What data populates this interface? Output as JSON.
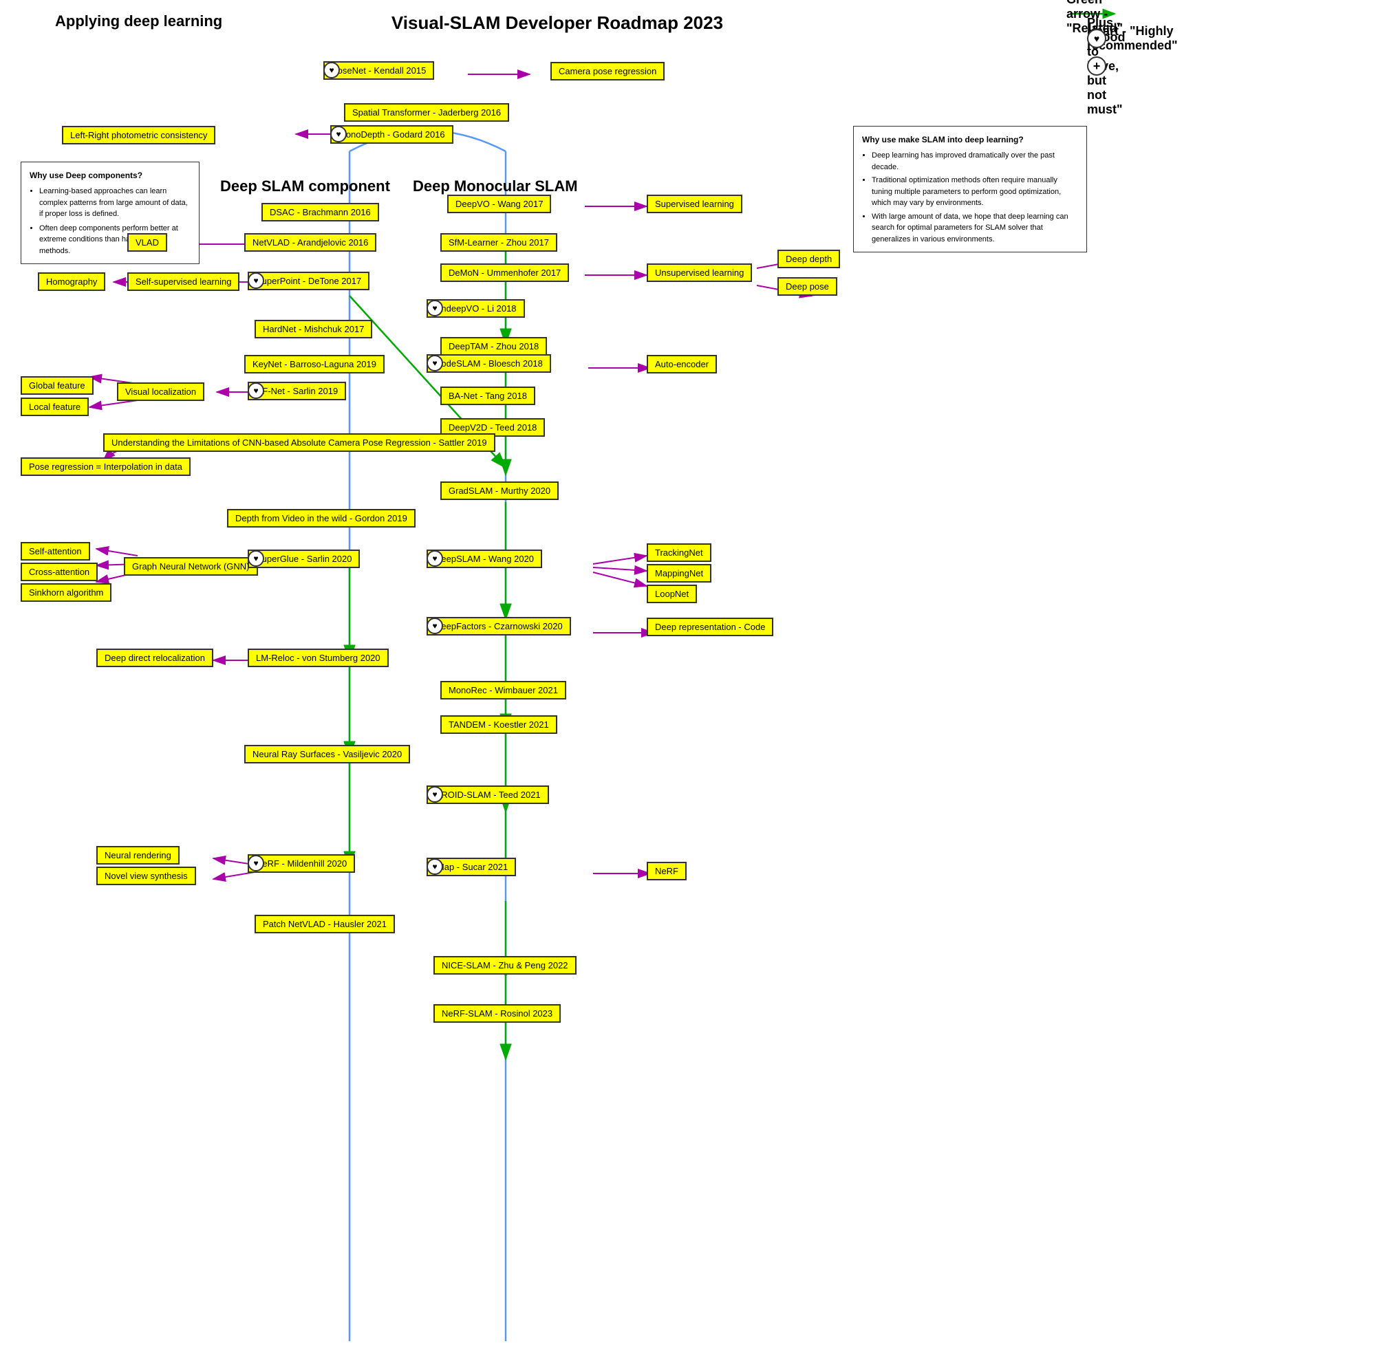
{
  "title": "Visual-SLAM Developer Roadmap 2023",
  "subtitle_left": "Applying deep learning",
  "legend": {
    "green_arrow": "Green arrow - \"Related\"",
    "heart": "Heart - \"Highly recommended\"",
    "plus": "Plus - \"Good to have, but not must\""
  },
  "nodes": {
    "posenet": "PoseNet - Kendall 2015",
    "camera_pose": "Camera pose regression",
    "spatial": "Spatial Transformer - Jaderberg 2016",
    "left_right": "Left-Right photometric consistency",
    "monodepth": "MonoDepth - Godard 2016",
    "dsac": "DSAC - Brachmann 2016",
    "deepvo": "DeepVO - Wang 2017",
    "supervised": "Supervised learning",
    "netvlad": "NetVLAD - Arandjelovic 2016",
    "vlad": "VLAD",
    "sfm": "SfM-Learner - Zhou 2017",
    "demon": "DeMoN - Ummenhofer 2017",
    "unsupervised": "Unsupervised learning",
    "deep_depth": "Deep depth",
    "deep_pose": "Deep pose",
    "superpoint": "SuperPoint - DeTone 2017",
    "self_supervised": "Self-supervised learning",
    "homography": "Homography",
    "undeepvo": "UndeepVO - Li 2018",
    "hardnet": "HardNet - Mishchuk 2017",
    "deeptam": "DeepTAM - Zhou 2018",
    "keynet": "KeyNet - Barroso-Laguna 2019",
    "codeslam": "CodeSLAM - Bloesch 2018",
    "auto_encoder": "Auto-encoder",
    "banet": "BA-Net - Tang 2018",
    "hfnet": "HF-Net - Sarlin 2019",
    "global_feature": "Global feature",
    "local_feature": "Local feature",
    "visual_loc": "Visual localization",
    "deepv2d": "DeepV2D - Teed 2018",
    "understanding": "Understanding the Limitations of CNN-based Absolute Camera Pose Regression - Sattler 2019",
    "pose_regression": "Pose regression = Interpolation in data",
    "gradslam": "GradSLAM - Murthy 2020",
    "depth_video": "Depth from Video in the wild - Gordon 2019",
    "deepslam": "DeepSLAM - Wang 2020",
    "trackingnet": "TrackingNet",
    "mappingnet": "MappingNet",
    "loopnet": "LoopNet",
    "self_attention": "Self-attention",
    "cross_attention": "Cross-attention",
    "sinkhorn": "Sinkhorn algorithm",
    "gnn": "Graph Neural Network (GNN)",
    "superglue": "SuperGlue - Sarlin 2020",
    "deepfactors": "DeepFactors - Czarnowski 2020",
    "deep_repr": "Deep representation - Code",
    "lm_reloc": "LM-Reloc - von Stumberg 2020",
    "deep_direct": "Deep direct relocalization",
    "monorec": "MonoRec - Wimbauer 2021",
    "tandem": "TANDEM - Koestler 2021",
    "neural_ray": "Neural Ray Surfaces - Vasiljevic 2020",
    "droid_slam": "DROID-SLAM - Teed 2021",
    "neural_rendering": "Neural rendering",
    "novel_view": "Novel view synthesis",
    "nerf_mildenhill": "NeRF - Mildenhill 2020",
    "imap": "iMap - Sucar 2021",
    "nerf_out": "NeRF",
    "patch_netvlad": "Patch NetVLAD - Hausler 2021",
    "nice_slam": "NICE-SLAM - Zhu & Peng 2022",
    "nerf_slam": "NeRF-SLAM - Rosinol 2023"
  },
  "infobox_left": {
    "title": "Why use Deep components?",
    "bullets": [
      "Learning-based approaches can learn complex patterns from large amount of data, if proper loss is defined.",
      "Often deep components perform better at extreme conditions than handcrafted methods."
    ]
  },
  "infobox_right": {
    "title": "Why use make SLAM into deep learning?",
    "bullets": [
      "Deep learning has improved dramatically over the past decade.",
      "Traditional optimization methods often require manually tuning multiple parameters to perform good optimization, which may vary by environments.",
      "With large amount of data, we hope that deep learning can search for optimal parameters for SLAM solver that generalizes in various environments."
    ]
  },
  "section_left": "Deep SLAM component",
  "section_right": "Deep Monocular SLAM"
}
